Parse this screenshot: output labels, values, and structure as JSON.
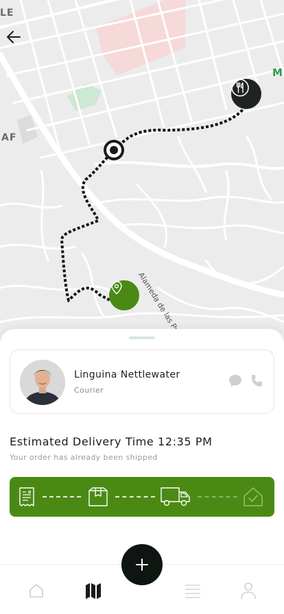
{
  "map": {
    "labels": {
      "left_top": "LE",
      "left_mid": "AF",
      "right": "M"
    },
    "street_name": "Alameda de las Pulgas",
    "icons": {
      "back": "arrow-left-icon",
      "restaurant": "fork-knife-icon",
      "courier": "location-dot-icon",
      "destination": "map-pin-icon"
    }
  },
  "courier": {
    "name": "Linguina Nettlewater",
    "role": "Courier",
    "actions": [
      "chat-bubble-icon",
      "phone-icon"
    ]
  },
  "delivery": {
    "eta": "Estimated Delivery Time 12:35 PM",
    "status": "Your order has already been shipped",
    "steps": [
      {
        "icon": "receipt-icon",
        "done": true
      },
      {
        "icon": "package-icon",
        "done": true
      },
      {
        "icon": "truck-icon",
        "done": true
      },
      {
        "icon": "home-check-icon",
        "done": false
      }
    ]
  },
  "bottom_nav": {
    "items": [
      {
        "icon": "home-icon",
        "active": false
      },
      {
        "icon": "map-icon",
        "active": true
      },
      {
        "icon": "list-icon",
        "active": false
      },
      {
        "icon": "user-icon",
        "active": false
      }
    ],
    "fab_icon": "plus-icon"
  },
  "colors": {
    "accent_green": "#4a8a14",
    "dark": "#1a1a1a",
    "map_background": "#ececec"
  }
}
